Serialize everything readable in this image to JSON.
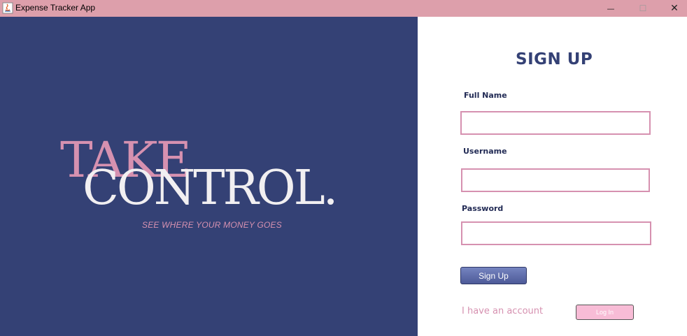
{
  "window": {
    "title": "Expense Tracker App",
    "icon": "java-icon",
    "controls": {
      "minimize": "—",
      "maximize": "☐",
      "close": "✕"
    }
  },
  "hero": {
    "line1": "TAKE",
    "line2": "CONTROL.",
    "tagline": "SEE WHERE YOUR MONEY GOES"
  },
  "form": {
    "heading": "SIGN UP",
    "full_name_label": "Full Name",
    "full_name_value": "",
    "username_label": "Username",
    "username_value": "",
    "password_label": "Password",
    "password_value": "",
    "signup_label": "Sign Up",
    "account_text": "I have an account",
    "login_label": "Log In"
  },
  "colors": {
    "titlebar": "#dd9fab",
    "navy": "#344175",
    "pink": "#d691b0",
    "button_blue": "#5d6aa8",
    "login_pink": "#f8bcd6"
  }
}
